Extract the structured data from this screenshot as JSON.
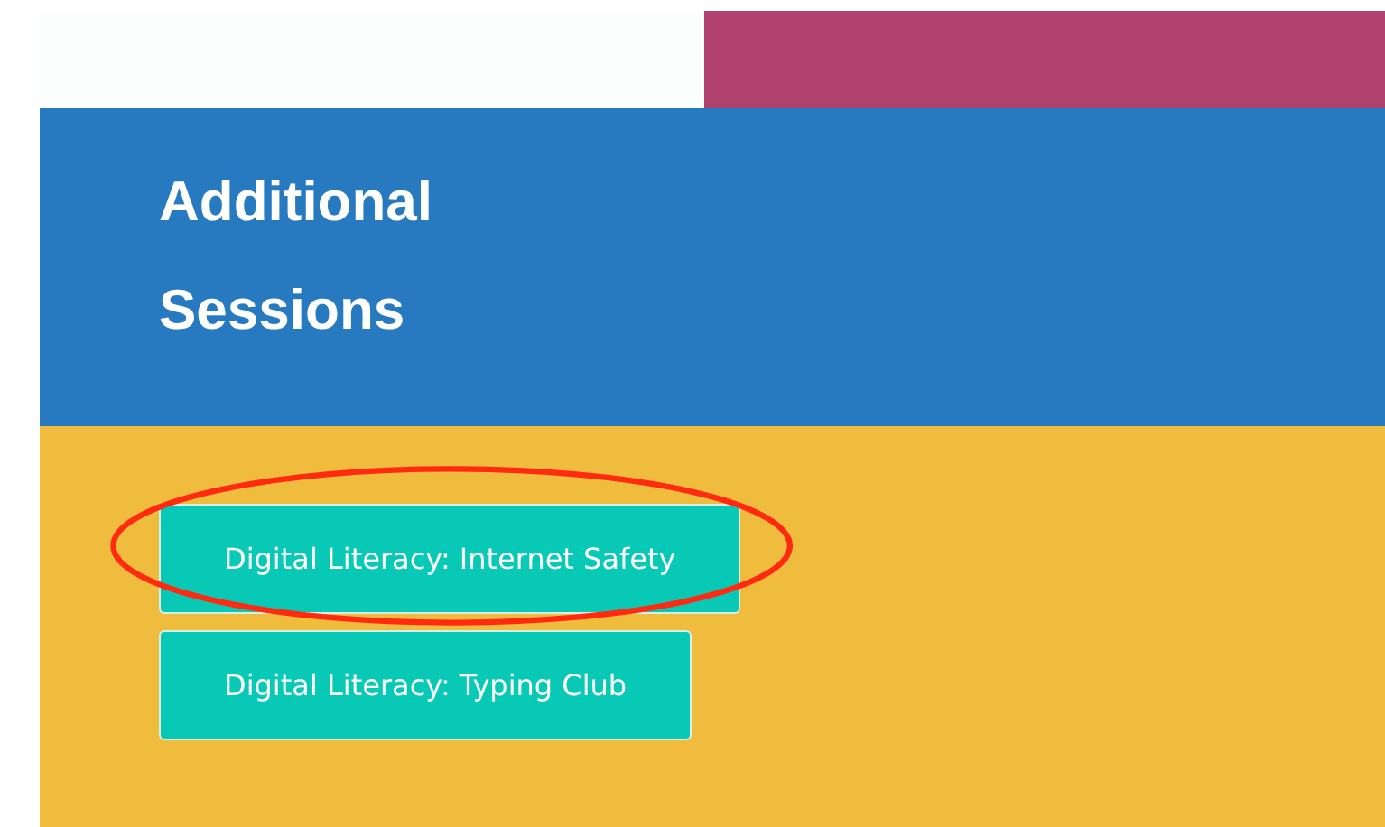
{
  "header": {
    "title_lines": [
      "Additional",
      "Sessions"
    ]
  },
  "sessions": [
    {
      "label": "Digital Literacy: Internet Safety",
      "highlighted": true
    },
    {
      "label": "Digital Literacy: Typing Club",
      "highlighted": false
    }
  ]
}
